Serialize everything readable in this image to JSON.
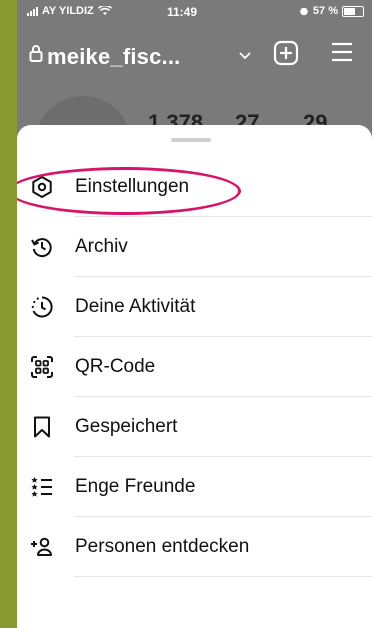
{
  "status_bar": {
    "carrier": "AY YILDIZ",
    "time": "11:49",
    "battery_text": "57 %"
  },
  "profile": {
    "username": "meike_fisc...",
    "stats": [
      "1.378",
      "27",
      "29"
    ]
  },
  "menu": {
    "items": [
      {
        "label": "Einstellungen",
        "icon": "settings-gear-icon"
      },
      {
        "label": "Archiv",
        "icon": "archive-history-icon"
      },
      {
        "label": "Deine Aktivität",
        "icon": "activity-icon"
      },
      {
        "label": "QR-Code",
        "icon": "qr-code-icon"
      },
      {
        "label": "Gespeichert",
        "icon": "bookmark-icon"
      },
      {
        "label": "Enge Freunde",
        "icon": "close-friends-list-icon"
      },
      {
        "label": "Personen entdecken",
        "icon": "add-person-icon"
      }
    ]
  },
  "annotation": {
    "color": "#d6146a"
  }
}
